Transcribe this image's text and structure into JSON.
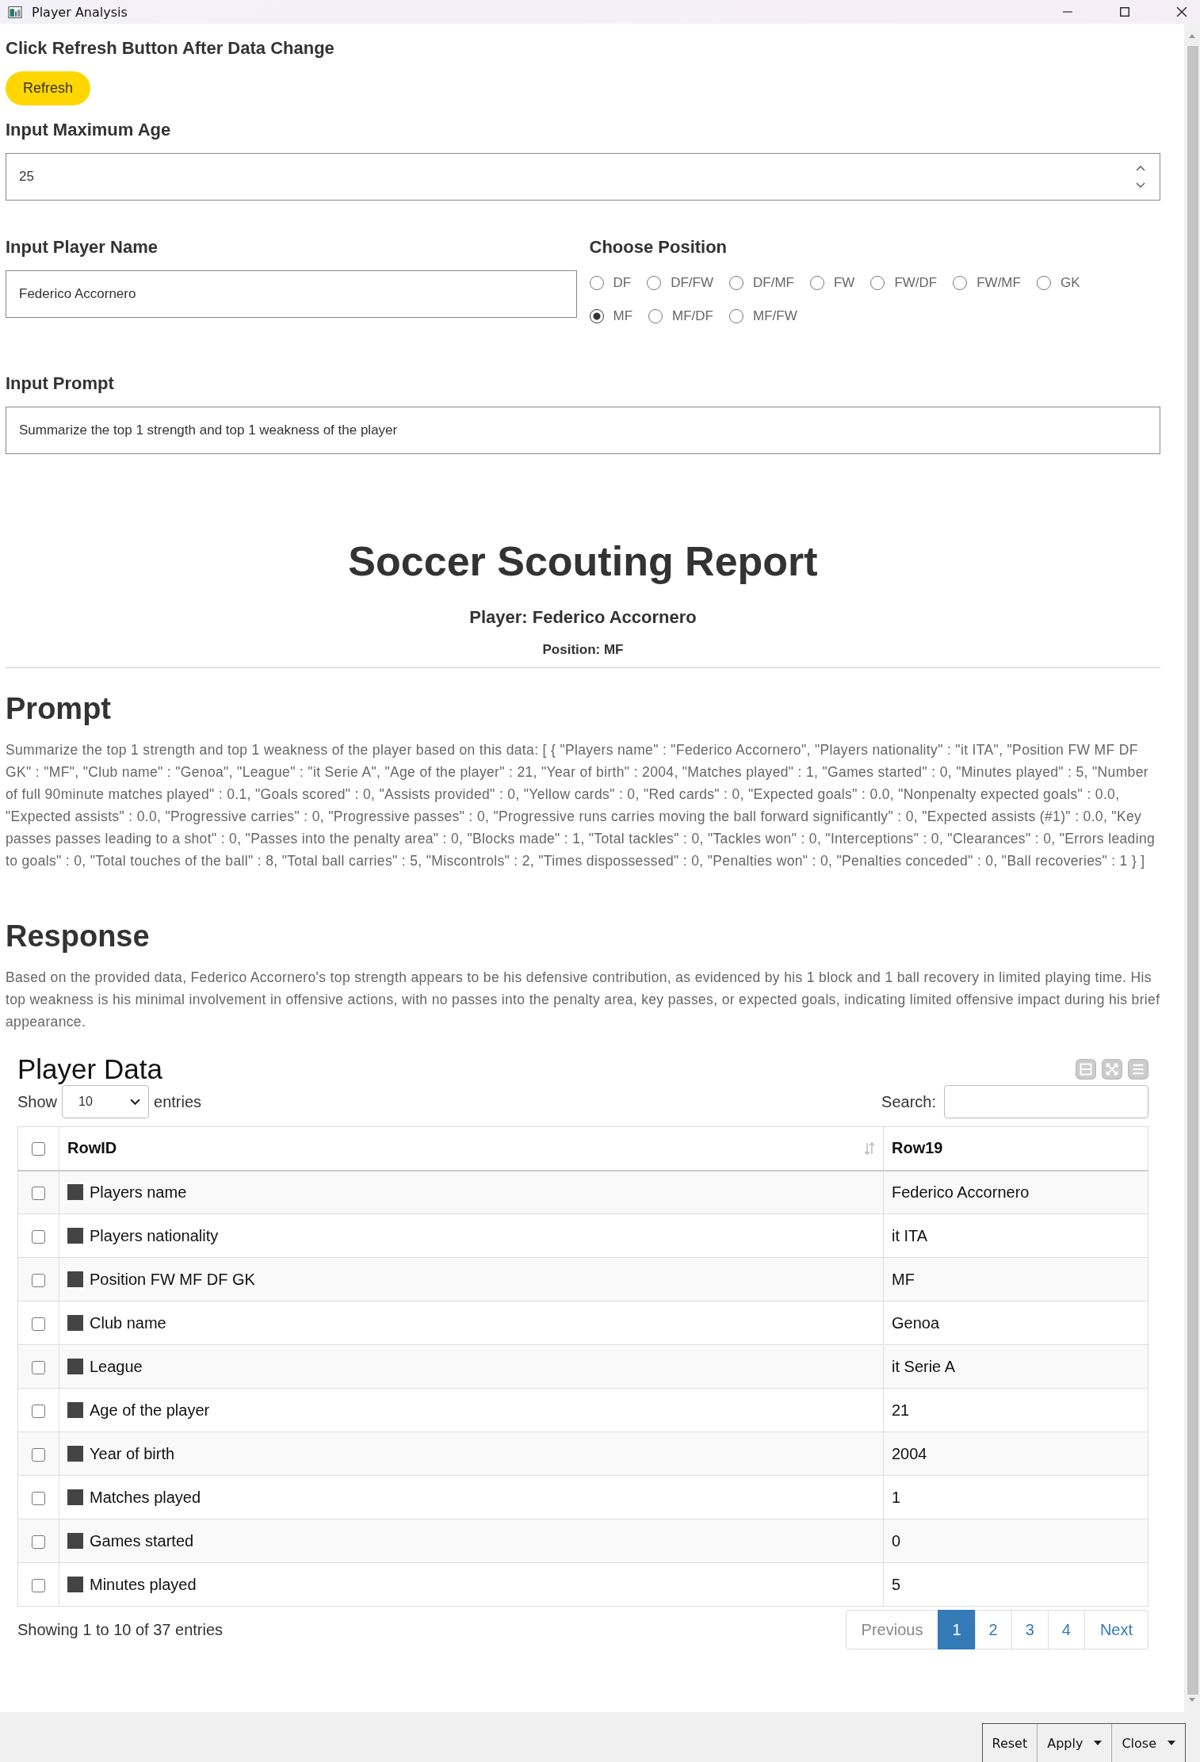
{
  "window": {
    "title": "Player Analysis"
  },
  "refresh_note": "Click Refresh Button After Data Change",
  "refresh_button": "Refresh",
  "max_age": {
    "label": "Input Maximum Age",
    "value": "25"
  },
  "player_name": {
    "label": "Input Player Name",
    "value": "Federico Accornero"
  },
  "position": {
    "label": "Choose Position",
    "options": [
      {
        "label": "DF",
        "selected": false
      },
      {
        "label": "DF/FW",
        "selected": false
      },
      {
        "label": "DF/MF",
        "selected": false
      },
      {
        "label": "FW",
        "selected": false
      },
      {
        "label": "FW/DF",
        "selected": false
      },
      {
        "label": "FW/MF",
        "selected": false
      },
      {
        "label": "GK",
        "selected": false
      },
      {
        "label": "MF",
        "selected": true
      },
      {
        "label": "MF/DF",
        "selected": false
      },
      {
        "label": "MF/FW",
        "selected": false
      }
    ]
  },
  "prompt_input": {
    "label": "Input Prompt",
    "value": "Summarize the top 1 strength and top 1 weakness of the player"
  },
  "report": {
    "title": "Soccer Scouting Report",
    "player": "Player: Federico Accornero",
    "position": "Position: MF"
  },
  "prompt_section": {
    "heading": "Prompt",
    "text": "Summarize the top 1 strength and top 1 weakness of the player based on this data: [ { \"Players name\" : \"Federico Accornero\", \"Players nationality\" : \"it ITA\", \"Position FW MF DF GK\" : \"MF\", \"Club name\" : \"Genoa\", \"League\" : \"it Serie A\", \"Age of the player\" : 21, \"Year of birth\" : 2004, \"Matches played\" : 1, \"Games started\" : 0, \"Minutes played\" : 5, \"Number of full 90minute matches played\" : 0.1, \"Goals scored\" : 0, \"Assists provided\" : 0, \"Yellow cards\" : 0, \"Red cards\" : 0, \"Expected goals\" : 0.0, \"Nonpenalty expected goals\" : 0.0, \"Expected assists\" : 0.0, \"Progressive carries\" : 0, \"Progressive passes\" : 0, \"Progressive runs carries moving the ball forward significantly\" : 0, \"Expected assists (#1)\" : 0.0, \"Key passes passes leading to a shot\" : 0, \"Passes into the penalty area\" : 0, \"Blocks made\" : 1, \"Total tackles\" : 0, \"Tackles won\" : 0, \"Interceptions\" : 0, \"Clearances\" : 0, \"Errors leading to goals\" : 0, \"Total touches of the ball\" : 8, \"Total ball carries\" : 5, \"Miscontrols\" : 2, \"Times dispossessed\" : 0, \"Penalties won\" : 0, \"Penalties conceded\" : 0, \"Ball recoveries\" : 1 } ]"
  },
  "response_section": {
    "heading": "Response",
    "text": "Based on the provided data, Federico Accornero's top strength appears to be his defensive contribution, as evidenced by his 1 block and 1 ball recovery in limited playing time. His top weakness is his minimal involvement in offensive actions, with no passes into the penalty area, key passes, or expected goals, indicating limited offensive impact during his brief appearance."
  },
  "player_data": {
    "title": "Player Data",
    "show_label": "Show",
    "page_length": "10",
    "entries_label": "entries",
    "search_label": "Search:",
    "header_checked": false,
    "columns": [
      "RowID",
      "Row19"
    ],
    "rows": [
      {
        "name": "Players name",
        "value": "Federico Accornero",
        "checked": false
      },
      {
        "name": "Players nationality",
        "value": "it ITA",
        "checked": false
      },
      {
        "name": "Position FW MF DF GK",
        "value": "MF",
        "checked": false
      },
      {
        "name": "Club name",
        "value": "Genoa",
        "checked": false
      },
      {
        "name": "League",
        "value": "it Serie A",
        "checked": false
      },
      {
        "name": "Age of the player",
        "value": "21",
        "checked": false
      },
      {
        "name": "Year of birth",
        "value": "2004",
        "checked": false
      },
      {
        "name": "Matches played",
        "value": "1",
        "checked": false
      },
      {
        "name": "Games started",
        "value": "0",
        "checked": false
      },
      {
        "name": "Minutes played",
        "value": "5",
        "checked": false
      }
    ],
    "info": "Showing 1 to 10 of 37 entries",
    "pagination": [
      {
        "label": "Previous",
        "kind": "nav",
        "selected": false
      },
      {
        "label": "1",
        "kind": "page",
        "selected": true
      },
      {
        "label": "2",
        "kind": "page",
        "selected": false
      },
      {
        "label": "3",
        "kind": "page",
        "selected": false
      },
      {
        "label": "4",
        "kind": "page",
        "selected": false
      },
      {
        "label": "Next",
        "kind": "nav",
        "selected": false
      }
    ]
  },
  "footer_buttons": [
    {
      "label": "Reset",
      "dropdown": false
    },
    {
      "label": "Apply",
      "dropdown": true
    },
    {
      "label": "Close",
      "dropdown": true
    }
  ]
}
